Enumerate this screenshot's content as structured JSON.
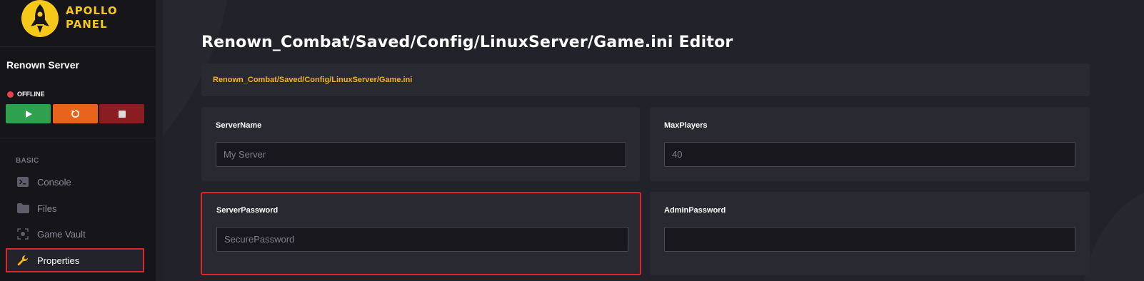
{
  "brand": {
    "line1": "APOLLO",
    "line2": "PANEL",
    "color": "#f6c81a"
  },
  "server": {
    "name": "Renown Server",
    "status": "OFFLINE",
    "status_color": "#e8414c"
  },
  "controls": [
    {
      "name": "start",
      "icon": "play-icon",
      "color": "#2fa04d"
    },
    {
      "name": "restart",
      "icon": "restart-icon",
      "color": "#e8641c"
    },
    {
      "name": "stop",
      "icon": "stop-icon",
      "color": "#8a1d22"
    }
  ],
  "sidebar": {
    "section": "BASIC",
    "items": [
      {
        "label": "Console",
        "icon": "terminal-icon",
        "active": false
      },
      {
        "label": "Files",
        "icon": "folder-icon",
        "active": false
      },
      {
        "label": "Game Vault",
        "icon": "vault-icon",
        "active": false
      },
      {
        "label": "Properties",
        "icon": "wrench-icon",
        "active": true
      }
    ]
  },
  "editor": {
    "title": "Renown_Combat/Saved/Config/LinuxServer/Game.ini Editor",
    "path": "Renown_Combat/Saved/Config/LinuxServer/Game.ini",
    "path_color": "#f4b31a",
    "fields": [
      {
        "label": "ServerName",
        "value": "",
        "placeholder": "My Server",
        "highlighted": false
      },
      {
        "label": "MaxPlayers",
        "value": "",
        "placeholder": "40",
        "highlighted": false
      },
      {
        "label": "ServerPassword",
        "value": "",
        "placeholder": "SecurePassword",
        "highlighted": true
      },
      {
        "label": "AdminPassword",
        "value": "",
        "placeholder": "",
        "highlighted": false
      }
    ]
  },
  "highlight_color": "#e0232e"
}
